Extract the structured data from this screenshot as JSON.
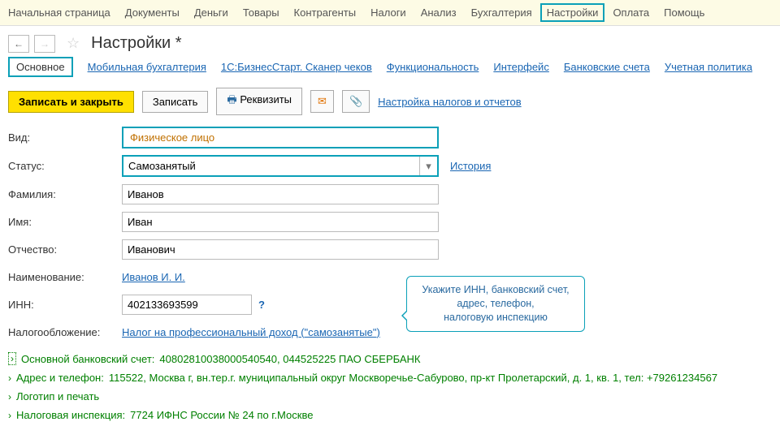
{
  "topmenu": {
    "items": [
      "Начальная страница",
      "Документы",
      "Деньги",
      "Товары",
      "Контрагенты",
      "Налоги",
      "Анализ",
      "Бухгалтерия",
      "Настройки",
      "Оплата",
      "Помощь"
    ],
    "active_index": 8
  },
  "header": {
    "title": "Настройки *"
  },
  "tabs": {
    "items": [
      "Основное",
      "Мобильная бухгалтерия",
      "1С:БизнесСтарт. Сканер чеков",
      "Функциональность",
      "Интерфейс",
      "Банковские счета",
      "Учетная политика"
    ],
    "active_index": 0
  },
  "toolbar": {
    "save_close": "Записать и закрыть",
    "save": "Записать",
    "requisites": "Реквизиты",
    "tax_settings_link": "Настройка налогов и отчетов"
  },
  "form": {
    "kind_label": "Вид:",
    "kind_value": "Физическое лицо",
    "status_label": "Статус:",
    "status_value": "Самозанятый",
    "history_link": "История",
    "lastname_label": "Фамилия:",
    "lastname_value": "Иванов",
    "firstname_label": "Имя:",
    "firstname_value": "Иван",
    "patronymic_label": "Отчество:",
    "patronymic_value": "Иванович",
    "name_label": "Наименование:",
    "name_link": "Иванов И. И.",
    "inn_label": "ИНН:",
    "inn_value": "402133693599",
    "tax_label": "Налогообложение:",
    "tax_link": "Налог на профессиональный доход (\"самозанятые\")"
  },
  "callout": {
    "line1": "Укажите ИНН, банковский счет,",
    "line2": "адрес, телефон,",
    "line3": "налоговую инспекцию"
  },
  "expanders": {
    "bank": {
      "label": "Основной банковский счет:",
      "value": "40802810038000540540, 044525225 ПАО СБЕРБАНК"
    },
    "address": {
      "label": "Адрес и телефон:",
      "value": "115522, Москва г, вн.тер.г. муниципальный округ Москворечье-Сабурово, пр-кт Пролетарский, д. 1, кв. 1, тел: +79261234567"
    },
    "logo": {
      "label": "Логотип и печать",
      "value": ""
    },
    "tax_office": {
      "label": "Налоговая инспекция:",
      "value": "7724 ИФНС России № 24 по г.Москве"
    }
  }
}
